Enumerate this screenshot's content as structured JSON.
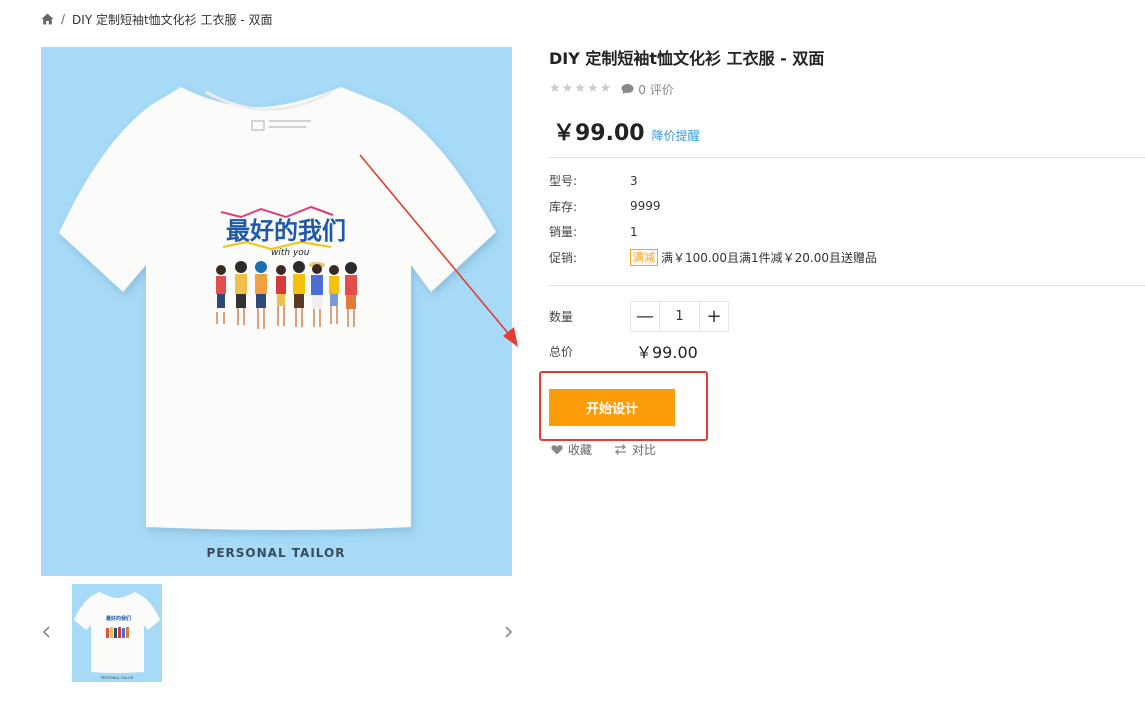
{
  "breadcrumb": {
    "home_icon": "home-icon",
    "separator": "/",
    "current": "DIY 定制短袖t恤文化衫 工衣服 - 双面"
  },
  "product_image": {
    "print_title": "最好的我们",
    "print_subtitle": "with you",
    "footer_text": "PERSONAL TAILOR",
    "background_color": "#a6daf6"
  },
  "gallery": {
    "prev_icon": "chevron-left-icon",
    "next_icon": "chevron-right-icon",
    "thumb_footer": "PERSONAL TAILOR"
  },
  "product": {
    "title": "DIY 定制短袖t恤文化衫 工衣服 - 双面",
    "rating_stars": 0,
    "reviews": "0 评价",
    "price": "￥99.00",
    "price_alert": "降价提醒",
    "props": [
      {
        "key": "型号:",
        "value": "3"
      },
      {
        "key": "库存:",
        "value": "9999"
      },
      {
        "key": "销量:",
        "value": "1"
      }
    ],
    "promo": {
      "key": "促销:",
      "tag": "满减",
      "text": "满￥100.00且满1件减￥20.00且送赠品"
    },
    "quantity": {
      "label": "数量",
      "value": "1",
      "minus": "—",
      "plus": "+"
    },
    "total": {
      "label": "总价",
      "value": "￥99.00"
    },
    "design_button": "开始设计",
    "favorite": "收藏",
    "compare": "对比"
  },
  "colors": {
    "accent_orange": "#fb9c0a",
    "link_blue": "#3a9ad9",
    "annotation_red": "#e53b36"
  }
}
